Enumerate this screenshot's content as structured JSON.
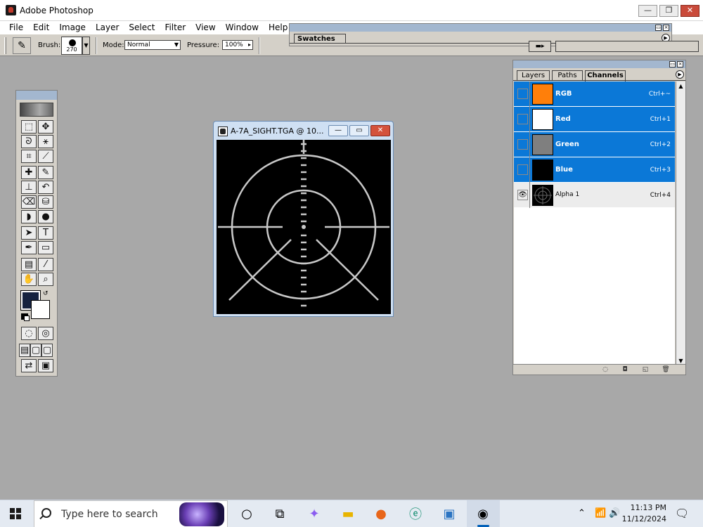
{
  "app": {
    "title": "Adobe Photoshop"
  },
  "menubar": [
    "File",
    "Edit",
    "Image",
    "Layer",
    "Select",
    "Filter",
    "View",
    "Window",
    "Help"
  ],
  "options": {
    "brush_label": "Brush:",
    "brush_size": "270",
    "mode_label": "Mode:",
    "mode_value": "Normal",
    "pressure_label": "Pressure:",
    "pressure_value": "100%"
  },
  "swatches": {
    "tab": "Swatches"
  },
  "toolbox": {
    "foreground_color": "#15223f",
    "background_color": "#ffffff",
    "tools": [
      "marquee-icon",
      "move-icon",
      "lasso-icon",
      "magic-wand-icon",
      "crop-icon",
      "slice-icon",
      "healing-icon",
      "brush-icon",
      "stamp-icon",
      "history-brush-icon",
      "eraser-icon",
      "bucket-icon",
      "blur-icon",
      "dodge-icon",
      "path-select-icon",
      "type-icon",
      "pen-icon",
      "shape-icon",
      "notes-icon",
      "eyedropper-icon",
      "hand-icon",
      "zoom-icon"
    ]
  },
  "document": {
    "title": "A-7A_SIGHT.TGA @ 10..."
  },
  "channels": {
    "tabs": [
      "Layers",
      "Paths",
      "Channels"
    ],
    "active_tab": "Channels",
    "rows": [
      {
        "name": "RGB",
        "shortcut": "Ctrl+~",
        "selected": true,
        "thumb": "#ff7f0a"
      },
      {
        "name": "Red",
        "shortcut": "Ctrl+1",
        "selected": true,
        "thumb": "#ffffff"
      },
      {
        "name": "Green",
        "shortcut": "Ctrl+2",
        "selected": true,
        "thumb": "#7f7f7f"
      },
      {
        "name": "Blue",
        "shortcut": "Ctrl+3",
        "selected": true,
        "thumb": "#000000"
      },
      {
        "name": "Alpha 1",
        "shortcut": "Ctrl+4",
        "selected": false,
        "thumb": "#000000"
      }
    ]
  },
  "taskbar": {
    "search_placeholder": "Type here to search",
    "time": "11:13 PM",
    "date": "11/12/2024"
  },
  "colors": {
    "selection_blue": "#0b78d7",
    "desktop_gray": "#a8a8a8"
  }
}
